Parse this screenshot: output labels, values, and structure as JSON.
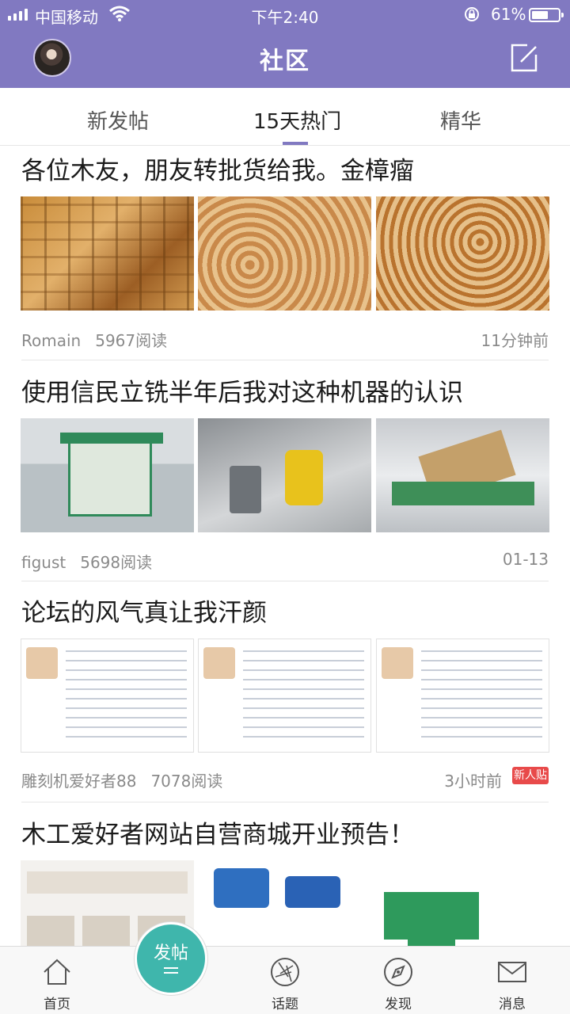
{
  "status_bar": {
    "carrier": "中国移动",
    "time": "下午2:40",
    "battery_pct_label": "61%",
    "battery_level": 0.61
  },
  "header": {
    "title": "社区"
  },
  "tabs": [
    {
      "label": "新发帖",
      "active": false
    },
    {
      "label": "15天热门",
      "active": true
    },
    {
      "label": "精华",
      "active": false
    }
  ],
  "posts": [
    {
      "title": "各位木友，朋友转批货给我。金樟瘤",
      "author": "Romain",
      "reads": "5967阅读",
      "time": "11分钟前"
    },
    {
      "title": "使用信民立铣半年后我对这种机器的认识",
      "author": "figust",
      "reads": "5698阅读",
      "time": "01-13"
    },
    {
      "title": "论坛的风气真让我汗颜",
      "author": "雕刻机爱好者88",
      "reads": "7078阅读",
      "time": "3小时前",
      "badge": "新人贴"
    },
    {
      "title": "木工爱好者网站自营商城开业预告！"
    }
  ],
  "bottom_nav": {
    "home": "首页",
    "post_button": "发帖",
    "topics": "话题",
    "discover": "发现",
    "messages": "消息"
  },
  "colors": {
    "header_bg": "#8179c1",
    "post_button": "#3fb6ac",
    "badge": "#e84a4a"
  }
}
